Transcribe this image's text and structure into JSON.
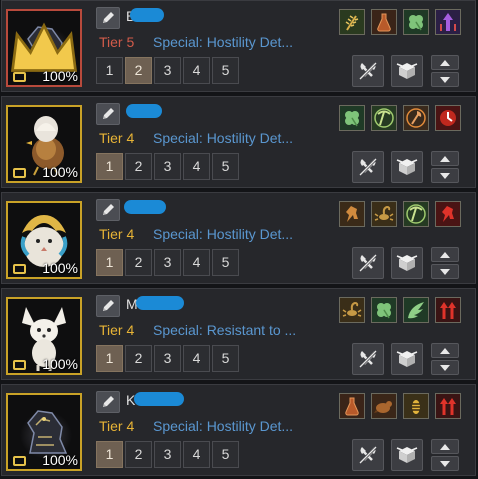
{
  "pets": [
    {
      "name": "B",
      "tier": "Tier 5",
      "tier_level": 5,
      "special": "Special: Hostility Det...",
      "hunger_percent": "100%",
      "active_slot": "2",
      "slots": [
        "1",
        "2",
        "3",
        "4",
        "5"
      ],
      "skills": [
        "wheat-skill-icon",
        "potion-skill-icon",
        "clover-skill-icon",
        "purple-arrow-skill-icon"
      ],
      "is_leader": true
    },
    {
      "name": "",
      "tier": "Tier 4",
      "tier_level": 4,
      "special": "Special: Hostility Det...",
      "hunger_percent": "100%",
      "active_slot": "1",
      "slots": [
        "1",
        "2",
        "3",
        "4",
        "5"
      ],
      "skills": [
        "clover-skill-icon",
        "pickaxe-skill-icon",
        "axe-skill-icon",
        "red-circle-skill-icon"
      ],
      "is_leader": false
    },
    {
      "name": "",
      "tier": "Tier 4",
      "tier_level": 4,
      "special": "Special: Hostility Det...",
      "hunger_percent": "100%",
      "active_slot": "1",
      "slots": [
        "1",
        "2",
        "3",
        "4",
        "5"
      ],
      "skills": [
        "horse-skill-icon",
        "scorpion-skill-icon",
        "pickaxe-skill-icon",
        "red-horse-skill-icon"
      ],
      "is_leader": false
    },
    {
      "name": "M",
      "tier": "Tier 4",
      "tier_level": 4,
      "special": "Special: Resistant to ...",
      "hunger_percent": "100%",
      "active_slot": "1",
      "slots": [
        "1",
        "2",
        "3",
        "4",
        "5"
      ],
      "skills": [
        "scorpion-skill-icon",
        "clover-skill-icon",
        "wing-skill-icon",
        "red-arrow-skill-icon"
      ],
      "is_leader": false
    },
    {
      "name": "K",
      "tier": "Tier 4",
      "tier_level": 4,
      "special": "Special: Hostility Det...",
      "hunger_percent": "100%",
      "active_slot": "1",
      "slots": [
        "1",
        "2",
        "3",
        "4",
        "5"
      ],
      "skills": [
        "potion-skill-icon",
        "beaver-skill-icon",
        "bee-skill-icon",
        "red-arrow-skill-icon"
      ],
      "is_leader": false
    }
  ],
  "colors": {
    "tier4": "#e8b436",
    "tier5": "#d25b4a",
    "special_text": "#5a97d0",
    "active_slot": "#6e6052",
    "name_redaction": "#1b8ad6"
  }
}
